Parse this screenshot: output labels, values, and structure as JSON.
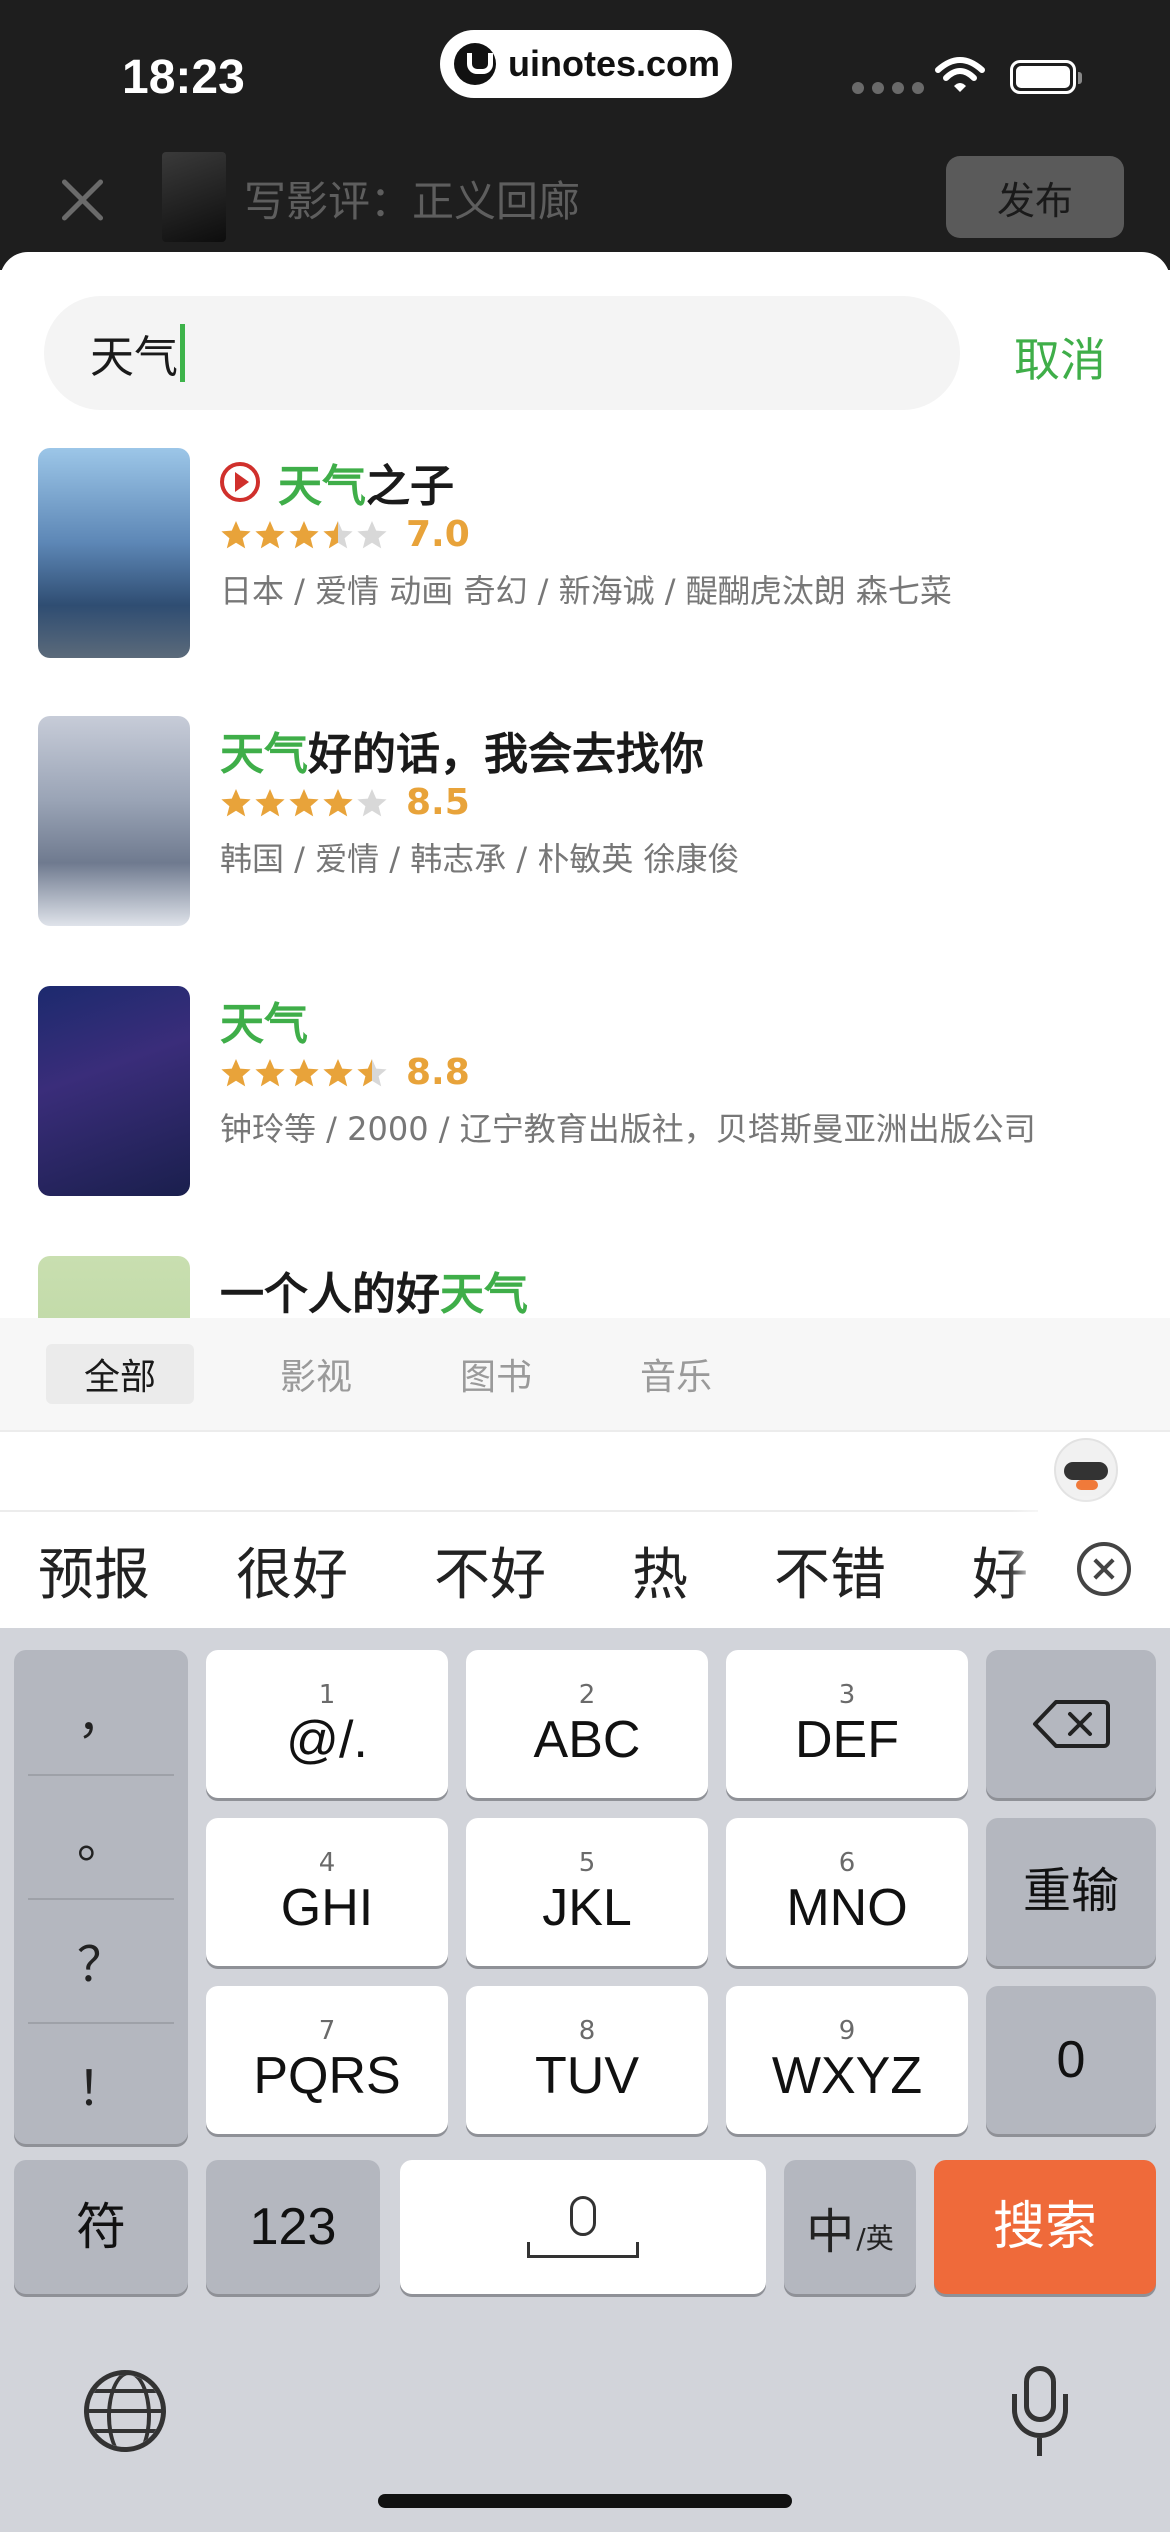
{
  "status_bar": {
    "time": "18:23",
    "url": "uinotes.com"
  },
  "header": {
    "title": "写影评：正义回廊",
    "publish_label": "发布"
  },
  "search": {
    "query": "天气",
    "cancel_label": "取消"
  },
  "results": [
    {
      "title_hl": "天气",
      "title_rest": "之子",
      "has_play": true,
      "stars": 3.5,
      "score": "7.0",
      "meta": "日本 / 爱情 动画 奇幻 / 新海诚 / 醍醐虎汰朗 森七菜"
    },
    {
      "title_hl": "天气",
      "title_rest": "好的话，我会去找你",
      "has_play": false,
      "stars": 4,
      "score": "8.5",
      "meta": "韩国 / 爱情 / 韩志承 / 朴敏英 徐康俊"
    },
    {
      "title_hl": "天气",
      "title_rest": "",
      "has_play": false,
      "stars": 4.5,
      "score": "8.8",
      "meta": "钟玲等 / 2000 / 辽宁教育出版社，贝塔斯曼亚洲出版公司"
    },
    {
      "title_pre": "一个人的好",
      "title_hl": "天气",
      "has_play": false
    }
  ],
  "tabs": [
    {
      "label": "全部",
      "active": true
    },
    {
      "label": "影视",
      "active": false
    },
    {
      "label": "图书",
      "active": false
    },
    {
      "label": "音乐",
      "active": false
    }
  ],
  "candidates": [
    "预报",
    "很好",
    "不好",
    "热",
    "不错",
    "好"
  ],
  "keyboard": {
    "punct": [
      "，",
      "。",
      "？",
      "！"
    ],
    "keys": [
      {
        "num": "1",
        "label": "@/."
      },
      {
        "num": "2",
        "label": "ABC"
      },
      {
        "num": "3",
        "label": "DEF"
      },
      {
        "num": "4",
        "label": "GHI"
      },
      {
        "num": "5",
        "label": "JKL"
      },
      {
        "num": "6",
        "label": "MNO"
      },
      {
        "num": "7",
        "label": "PQRS"
      },
      {
        "num": "8",
        "label": "TUV"
      },
      {
        "num": "9",
        "label": "WXYZ"
      }
    ],
    "retype_label": "重输",
    "zero_label": "0",
    "symbol_label": "符",
    "num_label": "123",
    "lang_main": "中",
    "lang_sub": "/英",
    "search_label": "搜索"
  },
  "colors": {
    "accent_green": "#3fae49",
    "star_orange": "#e8a33a",
    "search_key": "#ef6a3a",
    "play_red": "#d0302c"
  }
}
